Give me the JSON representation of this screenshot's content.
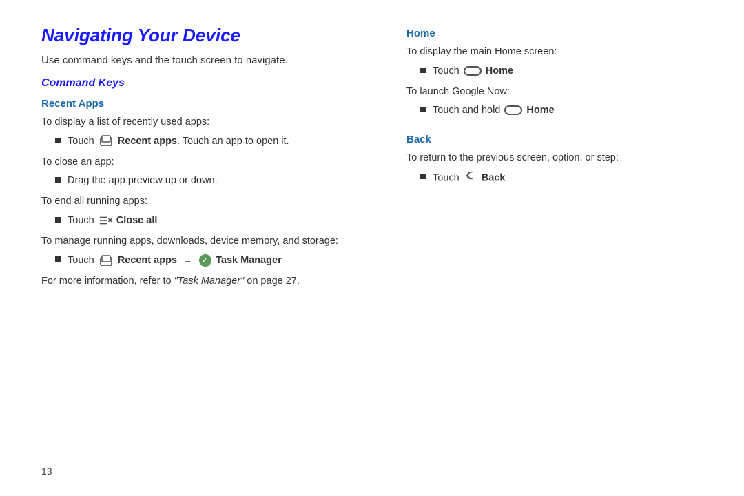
{
  "page": {
    "title": "Navigating Your Device",
    "intro": "Use command keys and the touch screen to navigate.",
    "page_number": "13"
  },
  "left_column": {
    "section_heading": "Command Keys",
    "subsection": {
      "heading": "Recent Apps",
      "block1": {
        "lead": "To display a list of recently used apps:",
        "bullet": "Touch",
        "bullet_bold": "Recent apps",
        "bullet_rest": ". Touch an app to open it."
      },
      "block2": {
        "lead": "To close an app:",
        "bullet": "Drag the app preview up or down."
      },
      "block3": {
        "lead": "To end all running apps:",
        "bullet_prefix": "Touch",
        "bullet_bold": "Close all",
        "bullet_rest": ""
      },
      "block4": {
        "lead": "To manage running apps, downloads, device memory, and storage:",
        "bullet_prefix": "Touch",
        "bullet_middle": "Recent apps",
        "bullet_arrow": "→",
        "bullet_bold": "Task Manager",
        "bullet_rest": ""
      },
      "footer": "For more information, refer to “Task Manager” on page 27."
    }
  },
  "right_column": {
    "home_section": {
      "heading": "Home",
      "block1": {
        "lead": "To display the main Home screen:",
        "bullet_prefix": "Touch",
        "bullet_bold": "Home",
        "bullet_rest": ""
      },
      "block2": {
        "lead": "To launch Google Now:",
        "bullet_prefix": "Touch and hold",
        "bullet_bold": "Home",
        "bullet_rest": ""
      }
    },
    "back_section": {
      "heading": "Back",
      "block1": {
        "lead": "To return to the previous screen, option, or step:",
        "bullet_prefix": "Touch",
        "bullet_bold": "Back",
        "bullet_rest": ""
      }
    }
  }
}
